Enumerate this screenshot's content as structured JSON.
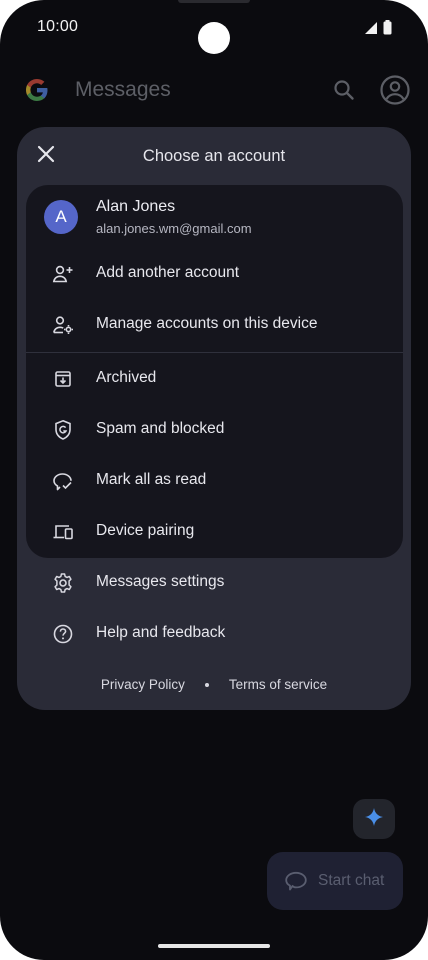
{
  "status_bar": {
    "time": "10:00"
  },
  "app_bar": {
    "title": "Messages",
    "logo_icon": "google-g-icon",
    "search_icon": "search-icon",
    "account_icon": "account-circle-icon"
  },
  "sheet": {
    "title": "Choose an account",
    "close_icon": "close-icon",
    "account": {
      "avatar_letter": "A",
      "name": "Alan Jones",
      "email": "alan.jones.wm@gmail.com",
      "avatar_color": "#5566c9"
    },
    "account_actions": [
      {
        "label": "Add another account",
        "icon": "person-add-icon"
      },
      {
        "label": "Manage accounts on this device",
        "icon": "manage-accounts-icon"
      }
    ],
    "menu": [
      {
        "label": "Archived",
        "icon": "archive-icon"
      },
      {
        "label": "Spam and blocked",
        "icon": "spam-shield-icon"
      },
      {
        "label": "Mark all as read",
        "icon": "mark-read-icon"
      },
      {
        "label": "Device pairing",
        "icon": "devices-icon"
      }
    ],
    "outer_menu": [
      {
        "label": "Messages settings",
        "icon": "settings-gear-icon"
      },
      {
        "label": "Help and feedback",
        "icon": "help-icon"
      }
    ],
    "footer": {
      "privacy_label": "Privacy Policy",
      "terms_label": "Terms of service"
    }
  },
  "fab": {
    "gemini_icon": "gemini-sparkle-icon",
    "start_chat_label": "Start chat",
    "start_chat_icon": "chat-bubble-icon"
  },
  "colors": {
    "background": "#0b0b0f",
    "sheet": "#2a2b37",
    "inner_card": "#15151d",
    "text": "#e8e8ee",
    "gemini_accent": "#6fa8ff"
  }
}
